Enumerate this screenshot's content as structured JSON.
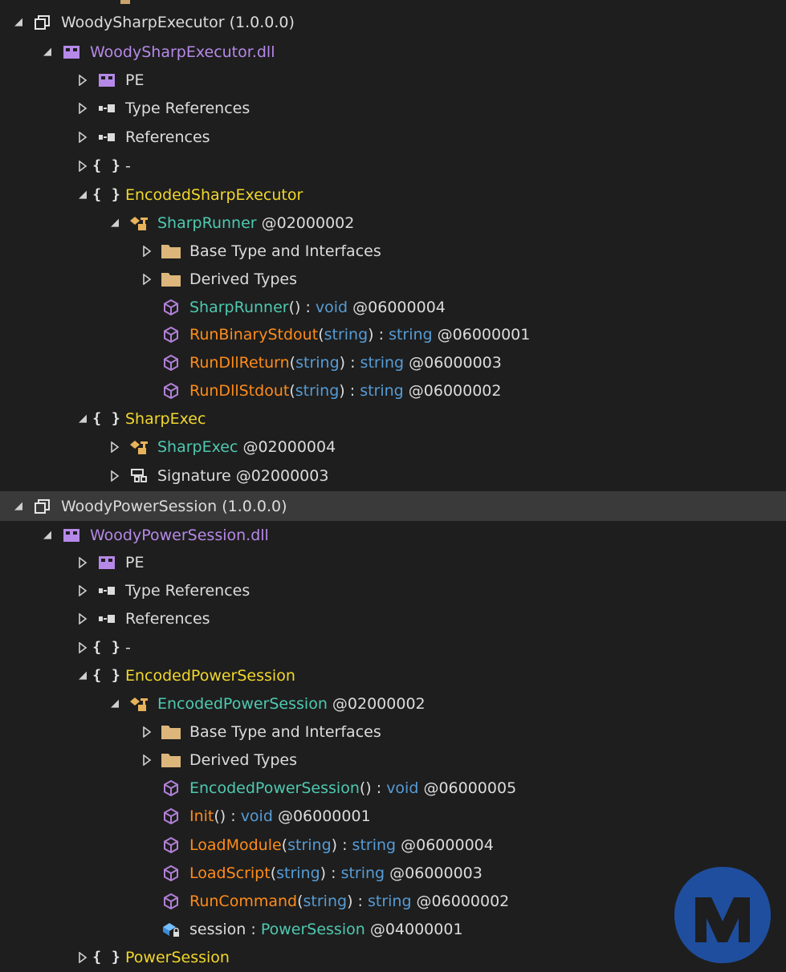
{
  "tree": [
    {
      "id": "r1",
      "expanded": true,
      "icon": "assembly-icon",
      "parts": [
        {
          "t": "WoodySharpExecutor (1.0.0.0)",
          "c": "gray"
        }
      ]
    },
    {
      "id": "r2",
      "expanded": true,
      "icon": "module-icon",
      "parts": [
        {
          "t": "WoodySharpExecutor.dll",
          "c": "purple"
        }
      ]
    },
    {
      "id": "r3",
      "expanded": false,
      "icon": "module-icon",
      "parts": [
        {
          "t": "PE",
          "c": "gray"
        }
      ]
    },
    {
      "id": "r4",
      "expanded": false,
      "icon": "references-icon",
      "parts": [
        {
          "t": "Type References",
          "c": "gray"
        }
      ]
    },
    {
      "id": "r5",
      "expanded": false,
      "icon": "references-icon",
      "parts": [
        {
          "t": "References",
          "c": "gray"
        }
      ]
    },
    {
      "id": "r6",
      "expanded": false,
      "icon": "namespace-icon",
      "parts": [
        {
          "t": "-",
          "c": "gray"
        }
      ]
    },
    {
      "id": "r7",
      "expanded": true,
      "icon": "namespace-icon",
      "parts": [
        {
          "t": "EncodedSharpExecutor",
          "c": "yellow"
        }
      ]
    },
    {
      "id": "r8",
      "expanded": true,
      "icon": "class-icon",
      "parts": [
        {
          "t": "SharpRunner",
          "c": "teal"
        },
        {
          "t": " @02000002",
          "c": "gray"
        }
      ]
    },
    {
      "id": "r9",
      "expanded": false,
      "icon": "folder-icon",
      "parts": [
        {
          "t": "Base Type and Interfaces",
          "c": "gray"
        }
      ]
    },
    {
      "id": "r10",
      "expanded": false,
      "icon": "folder-icon",
      "parts": [
        {
          "t": "Derived Types",
          "c": "gray"
        }
      ]
    },
    {
      "id": "r11",
      "expanded": null,
      "icon": "method-icon",
      "parts": [
        {
          "t": "SharpRunner",
          "c": "teal"
        },
        {
          "t": "() : ",
          "c": "gray"
        },
        {
          "t": "void",
          "c": "blue"
        },
        {
          "t": " @06000004",
          "c": "gray"
        }
      ]
    },
    {
      "id": "r12",
      "expanded": null,
      "icon": "method-icon",
      "parts": [
        {
          "t": "RunBinaryStdout",
          "c": "orange"
        },
        {
          "t": "(",
          "c": "gray"
        },
        {
          "t": "string",
          "c": "blue"
        },
        {
          "t": ") : ",
          "c": "gray"
        },
        {
          "t": "string",
          "c": "blue"
        },
        {
          "t": " @06000001",
          "c": "gray"
        }
      ]
    },
    {
      "id": "r13",
      "expanded": null,
      "icon": "method-icon",
      "parts": [
        {
          "t": "RunDllReturn",
          "c": "orange"
        },
        {
          "t": "(",
          "c": "gray"
        },
        {
          "t": "string",
          "c": "blue"
        },
        {
          "t": ") : ",
          "c": "gray"
        },
        {
          "t": "string",
          "c": "blue"
        },
        {
          "t": " @06000003",
          "c": "gray"
        }
      ]
    },
    {
      "id": "r14",
      "expanded": null,
      "icon": "method-icon",
      "parts": [
        {
          "t": "RunDllStdout",
          "c": "orange"
        },
        {
          "t": "(",
          "c": "gray"
        },
        {
          "t": "string",
          "c": "blue"
        },
        {
          "t": ") : ",
          "c": "gray"
        },
        {
          "t": "string",
          "c": "blue"
        },
        {
          "t": " @06000002",
          "c": "gray"
        }
      ]
    },
    {
      "id": "r15",
      "expanded": true,
      "icon": "namespace-icon",
      "parts": [
        {
          "t": "SharpExec",
          "c": "yellow"
        }
      ]
    },
    {
      "id": "r16",
      "expanded": false,
      "icon": "class-icon",
      "parts": [
        {
          "t": "SharpExec",
          "c": "teal"
        },
        {
          "t": " @02000004",
          "c": "gray"
        }
      ]
    },
    {
      "id": "r17",
      "expanded": false,
      "icon": "struct-icon",
      "parts": [
        {
          "t": "Signature",
          "c": "gray"
        },
        {
          "t": " @02000003",
          "c": "gray"
        }
      ]
    },
    {
      "id": "r18",
      "expanded": true,
      "icon": "assembly-icon",
      "selected": true,
      "parts": [
        {
          "t": "WoodyPowerSession (1.0.0.0)",
          "c": "gray"
        }
      ]
    },
    {
      "id": "r19",
      "expanded": true,
      "icon": "module-icon",
      "parts": [
        {
          "t": "WoodyPowerSession.dll",
          "c": "purple"
        }
      ]
    },
    {
      "id": "r20",
      "expanded": false,
      "icon": "module-icon",
      "parts": [
        {
          "t": "PE",
          "c": "gray"
        }
      ]
    },
    {
      "id": "r21",
      "expanded": false,
      "icon": "references-icon",
      "parts": [
        {
          "t": "Type References",
          "c": "gray"
        }
      ]
    },
    {
      "id": "r22",
      "expanded": false,
      "icon": "references-icon",
      "parts": [
        {
          "t": "References",
          "c": "gray"
        }
      ]
    },
    {
      "id": "r23",
      "expanded": false,
      "icon": "namespace-icon",
      "parts": [
        {
          "t": "-",
          "c": "gray"
        }
      ]
    },
    {
      "id": "r24",
      "expanded": true,
      "icon": "namespace-icon",
      "parts": [
        {
          "t": "EncodedPowerSession",
          "c": "yellow"
        }
      ]
    },
    {
      "id": "r25",
      "expanded": true,
      "icon": "class-icon",
      "parts": [
        {
          "t": "EncodedPowerSession",
          "c": "teal"
        },
        {
          "t": " @02000002",
          "c": "gray"
        }
      ]
    },
    {
      "id": "r26",
      "expanded": false,
      "icon": "folder-icon",
      "parts": [
        {
          "t": "Base Type and Interfaces",
          "c": "gray"
        }
      ]
    },
    {
      "id": "r27",
      "expanded": false,
      "icon": "folder-icon",
      "parts": [
        {
          "t": "Derived Types",
          "c": "gray"
        }
      ]
    },
    {
      "id": "r28",
      "expanded": null,
      "icon": "method-icon",
      "parts": [
        {
          "t": "EncodedPowerSession",
          "c": "teal"
        },
        {
          "t": "() : ",
          "c": "gray"
        },
        {
          "t": "void",
          "c": "blue"
        },
        {
          "t": " @06000005",
          "c": "gray"
        }
      ]
    },
    {
      "id": "r29",
      "expanded": null,
      "icon": "method-icon",
      "parts": [
        {
          "t": "Init",
          "c": "orange"
        },
        {
          "t": "() : ",
          "c": "gray"
        },
        {
          "t": "void",
          "c": "blue"
        },
        {
          "t": " @06000001",
          "c": "gray"
        }
      ]
    },
    {
      "id": "r30",
      "expanded": null,
      "icon": "method-icon",
      "parts": [
        {
          "t": "LoadModule",
          "c": "orange"
        },
        {
          "t": "(",
          "c": "gray"
        },
        {
          "t": "string",
          "c": "blue"
        },
        {
          "t": ") : ",
          "c": "gray"
        },
        {
          "t": "string",
          "c": "blue"
        },
        {
          "t": " @06000004",
          "c": "gray"
        }
      ]
    },
    {
      "id": "r31",
      "expanded": null,
      "icon": "method-icon",
      "parts": [
        {
          "t": "LoadScript",
          "c": "orange"
        },
        {
          "t": "(",
          "c": "gray"
        },
        {
          "t": "string",
          "c": "blue"
        },
        {
          "t": ") : ",
          "c": "gray"
        },
        {
          "t": "string",
          "c": "blue"
        },
        {
          "t": " @06000003",
          "c": "gray"
        }
      ]
    },
    {
      "id": "r32",
      "expanded": null,
      "icon": "method-icon",
      "parts": [
        {
          "t": "RunCommand",
          "c": "orange"
        },
        {
          "t": "(",
          "c": "gray"
        },
        {
          "t": "string",
          "c": "blue"
        },
        {
          "t": ") : ",
          "c": "gray"
        },
        {
          "t": "string",
          "c": "blue"
        },
        {
          "t": " @06000002",
          "c": "gray"
        }
      ]
    },
    {
      "id": "r33",
      "expanded": null,
      "icon": "field-icon",
      "parts": [
        {
          "t": "session",
          "c": "gray"
        },
        {
          "t": " : ",
          "c": "gray"
        },
        {
          "t": "PowerSession",
          "c": "teal"
        },
        {
          "t": " @04000001",
          "c": "gray"
        }
      ]
    },
    {
      "id": "r34",
      "expanded": false,
      "icon": "namespace-icon",
      "parts": [
        {
          "t": "PowerSession",
          "c": "yellow"
        }
      ]
    }
  ],
  "colors": {
    "background": "#1e1e1e",
    "selection": "#3a3a3a",
    "gray": "#dcdcdc",
    "purple": "#b689e8",
    "yellow": "#f2d72b",
    "teal": "#4ec9b0",
    "orange": "#ff8c1a",
    "blue": "#569cd6",
    "logo": "#1f4e9e"
  },
  "logo_icon": "malwarebytes-logo-icon"
}
